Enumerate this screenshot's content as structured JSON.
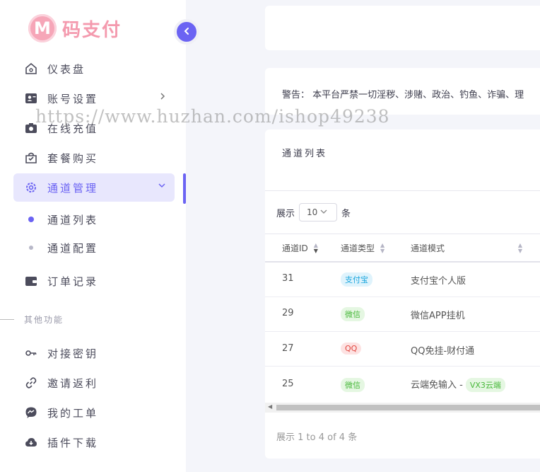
{
  "brand": {
    "logo_letter": "M",
    "name": "码支付"
  },
  "sidebar": {
    "items": [
      {
        "label": "仪表盘",
        "icon": "home-icon"
      },
      {
        "label": "账号设置",
        "icon": "id-card-icon"
      },
      {
        "label": "在线充值",
        "icon": "camera-icon"
      },
      {
        "label": "套餐购买",
        "icon": "shopping-bag-icon"
      },
      {
        "label": "通道管理",
        "icon": "gear-icon"
      },
      {
        "label": "订单记录",
        "icon": "wallet-icon"
      }
    ],
    "sub_items": [
      {
        "label": "通道列表"
      },
      {
        "label": "通道配置"
      }
    ],
    "section_label": "其他功能",
    "other_items": [
      {
        "label": "对接密钥",
        "icon": "key-icon"
      },
      {
        "label": "邀请返利",
        "icon": "link-icon"
      },
      {
        "label": "我的工单",
        "icon": "messenger-icon"
      },
      {
        "label": "插件下载",
        "icon": "cloud-download-icon"
      }
    ]
  },
  "notice": {
    "text": "警告： 本平台严禁一切淫秽、涉赌、政治、钓鱼、诈骗、理"
  },
  "channel_list": {
    "title": "通道列表",
    "show_prefix": "展示",
    "page_size": "10",
    "show_suffix": "条",
    "columns": [
      "通道ID",
      "通道类型",
      "通道模式"
    ],
    "rows": [
      {
        "id": "31",
        "type": "支付宝",
        "type_kind": "ali",
        "mode": "支付宝个人版",
        "mode_badge": ""
      },
      {
        "id": "29",
        "type": "微信",
        "type_kind": "wx",
        "mode": "微信APP挂机",
        "mode_badge": ""
      },
      {
        "id": "27",
        "type": "QQ",
        "type_kind": "qq",
        "mode": "QQ免挂-财付通",
        "mode_badge": ""
      },
      {
        "id": "25",
        "type": "微信",
        "type_kind": "wx",
        "mode": "云端免输入 -",
        "mode_badge": "VX3云端"
      }
    ],
    "footer": "展示 1 to 4 of 4 条"
  },
  "watermark": "https://www.huzhan.com/ishop49238"
}
